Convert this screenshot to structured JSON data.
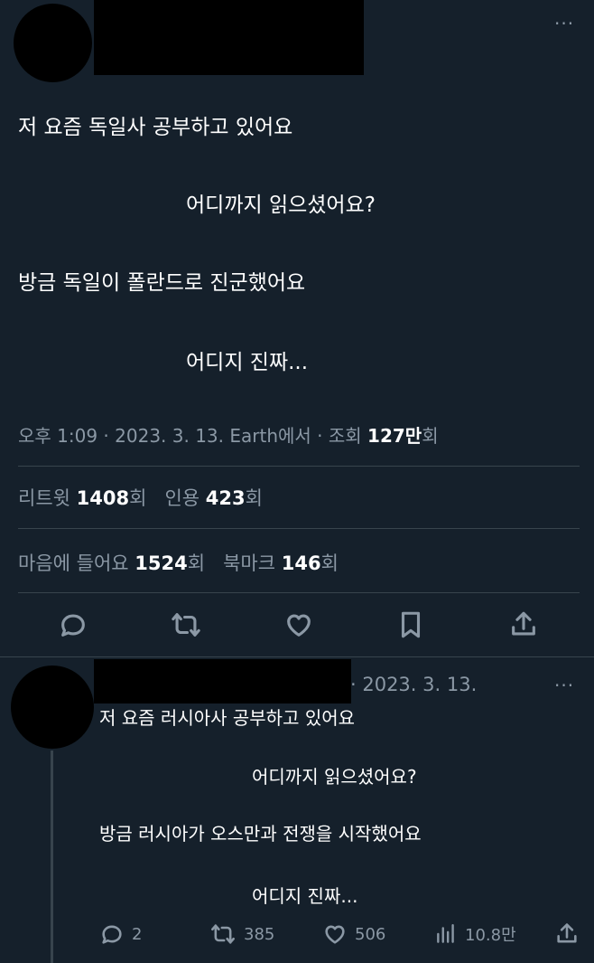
{
  "main_tweet": {
    "lines": [
      "저 요즘 독일사 공부하고 있어요",
      "어디까지 읽으셨어요?",
      "방금 독일이 폴란드로 진군했어요",
      "어디지 진짜..."
    ],
    "meta_prefix": "오후 1:09 · 2023. 3. 13. Earth에서 · 조회 ",
    "views": "127만",
    "views_suffix": "회",
    "retweet_label": "리트윗 ",
    "retweet_count": "1408",
    "retweet_suffix": "회",
    "quote_label": "인용 ",
    "quote_count": "423",
    "quote_suffix": "회",
    "like_label": "마음에 들어요 ",
    "like_count": "1524",
    "like_suffix": "회",
    "bookmark_label": "북마크 ",
    "bookmark_count": "146",
    "bookmark_suffix": "회",
    "more_icon": "···"
  },
  "reply_tweet": {
    "date": "· 2023. 3. 13.",
    "lines": [
      "저 요즘 러시아사 공부하고 있어요",
      "어디까지 읽으셨어요?",
      "방금 러시아가 오스만과 전쟁을 시작했어요",
      "어디지 진짜..."
    ],
    "reply_count": "2",
    "retweet_count": "385",
    "like_count": "506",
    "views_count": "10.8만",
    "more_icon": "···"
  },
  "icons": [
    "reply-icon",
    "retweet-icon",
    "like-icon",
    "bookmark-icon",
    "share-icon",
    "views-icon",
    "more-icon"
  ],
  "colors": {
    "background": "#15202b",
    "muted": "#8b98a5",
    "divider": "#38444d",
    "text": "#ffffff"
  }
}
